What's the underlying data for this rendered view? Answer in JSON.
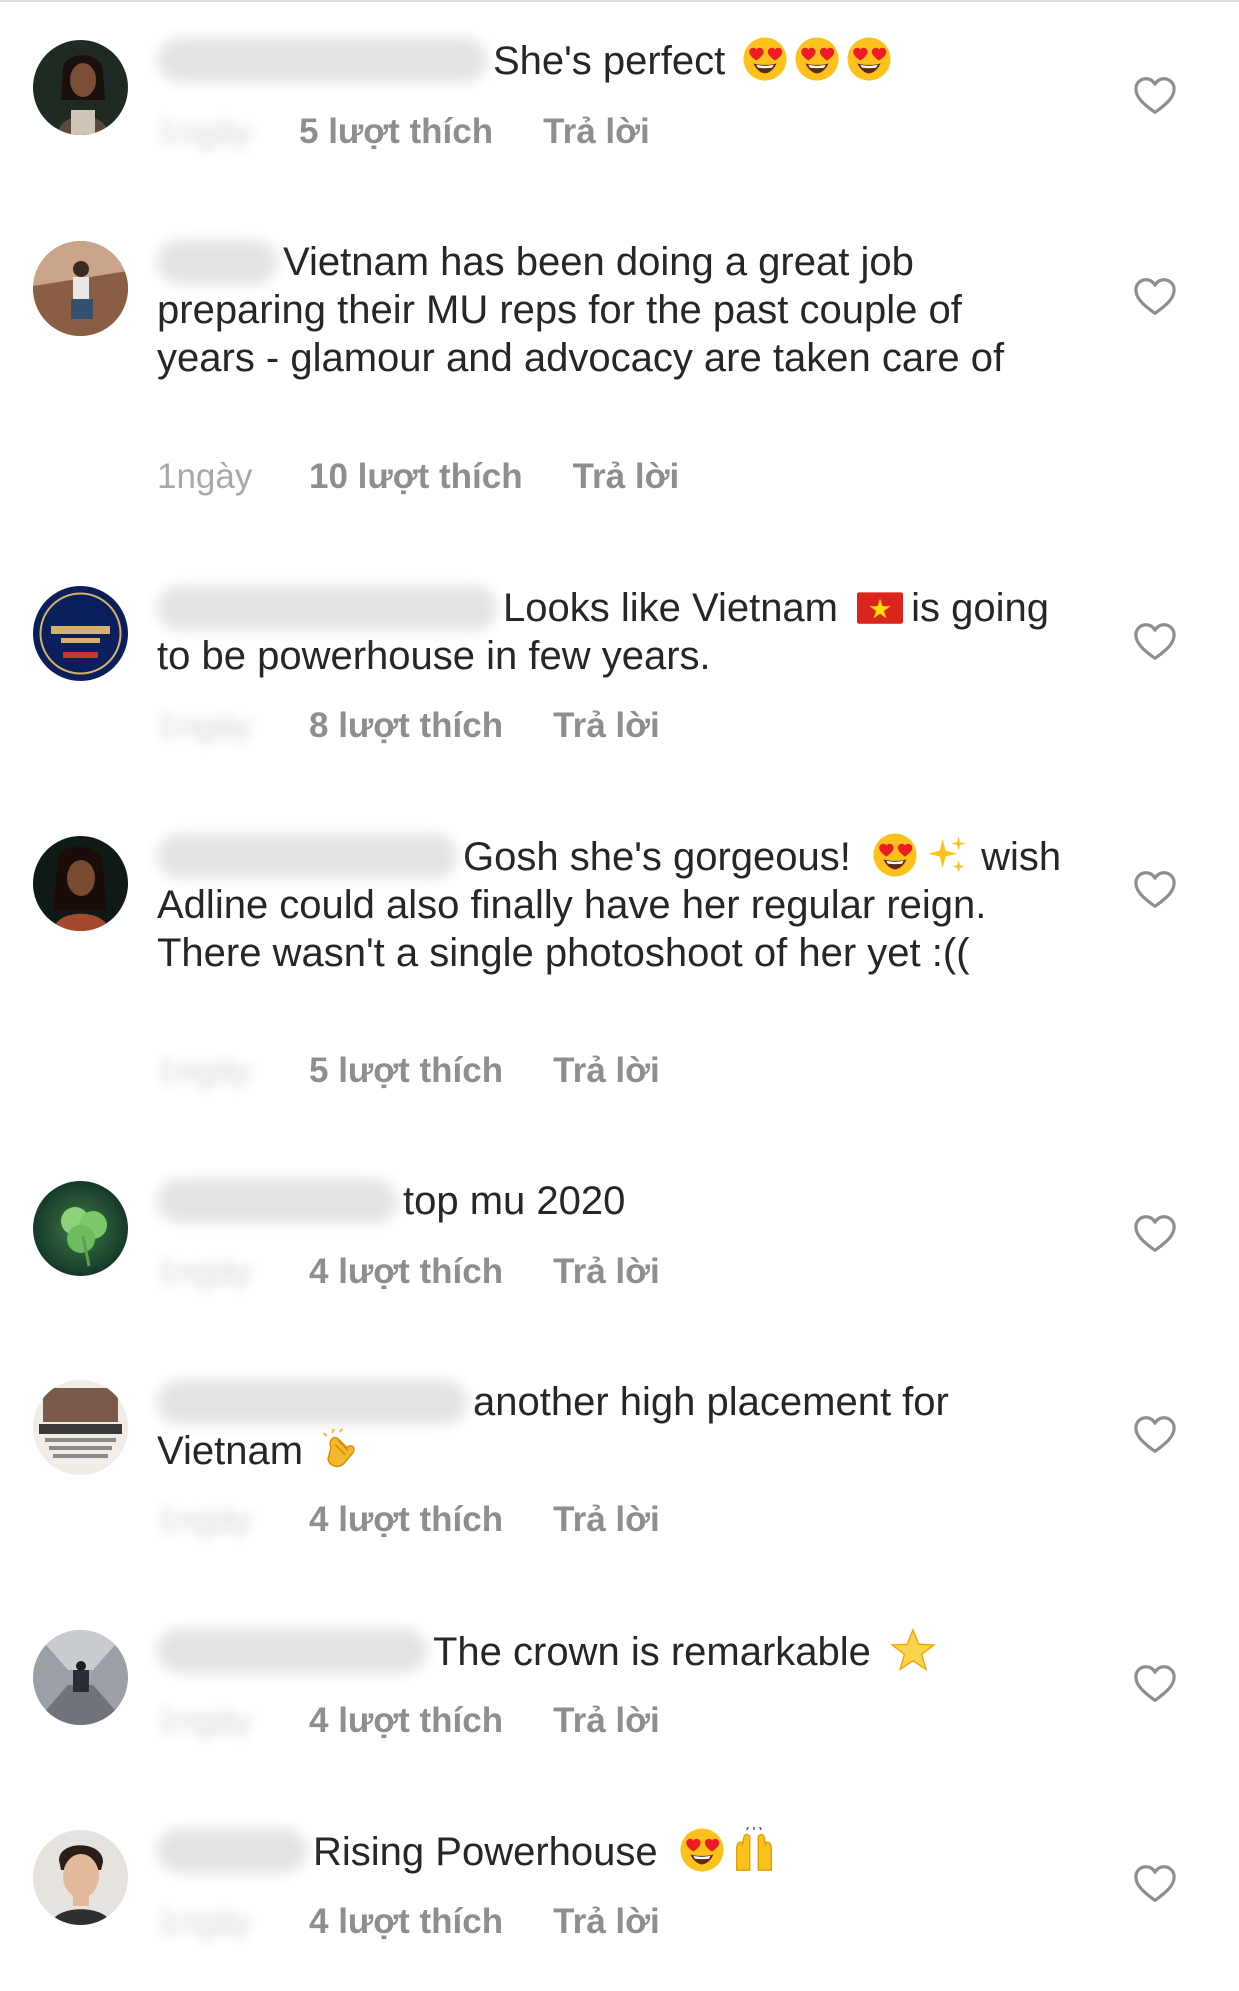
{
  "comments": [
    {
      "text": "She's perfect",
      "emojis": [
        "heart-eyes",
        "heart-eyes",
        "heart-eyes"
      ],
      "time": "",
      "likes": "5 lượt thích",
      "reply": "Trả lời"
    },
    {
      "text": "Vietnam has been doing a great job preparing their MU reps for the past couple of years - glamour and advocacy are taken care of",
      "emojis": [],
      "time": "1ngày",
      "likes": "10 lượt thích",
      "reply": "Trả lời"
    },
    {
      "text_before": "Looks like Vietnam",
      "text_after": "is going to be powerhouse in few years.",
      "emojis": [
        "vietnam-flag"
      ],
      "time": "",
      "likes": "8 lượt thích",
      "reply": "Trả lời"
    },
    {
      "text_before": "Gosh she's gorgeous!",
      "text_after": "wish Adline could also finally have her regular reign. There wasn't a single photoshoot of her yet :((",
      "emojis": [
        "heart-eyes",
        "sparkles"
      ],
      "time": "",
      "likes": "5 lượt thích",
      "reply": "Trả lời"
    },
    {
      "text": "top mu 2020",
      "emojis": [],
      "time": "",
      "likes": "4 lượt thích",
      "reply": "Trả lời"
    },
    {
      "text_before": "another high placement for Vietnam",
      "emojis": [
        "clapping-hands"
      ],
      "time": "",
      "likes": "4 lượt thích",
      "reply": "Trả lời"
    },
    {
      "text": "The crown is remarkable",
      "emojis": [
        "star"
      ],
      "time": "",
      "likes": "4 lượt thích",
      "reply": "Trả lời"
    },
    {
      "text": "Rising Powerhouse",
      "emojis": [
        "heart-eyes",
        "raising-hands"
      ],
      "time": "",
      "likes": "4 lượt thích",
      "reply": "Trả lời"
    }
  ],
  "avatars": [
    "woman-portrait",
    "man-sitting",
    "miss-nepal-2020-badge",
    "woman-portrait-dark",
    "clover-leaf",
    "barbershop-logo",
    "tunnel-photo",
    "man-portrait"
  ],
  "colors": {
    "text": "#262626",
    "meta": "#8e8e8e",
    "heart_outline": "#8e8e8e"
  }
}
